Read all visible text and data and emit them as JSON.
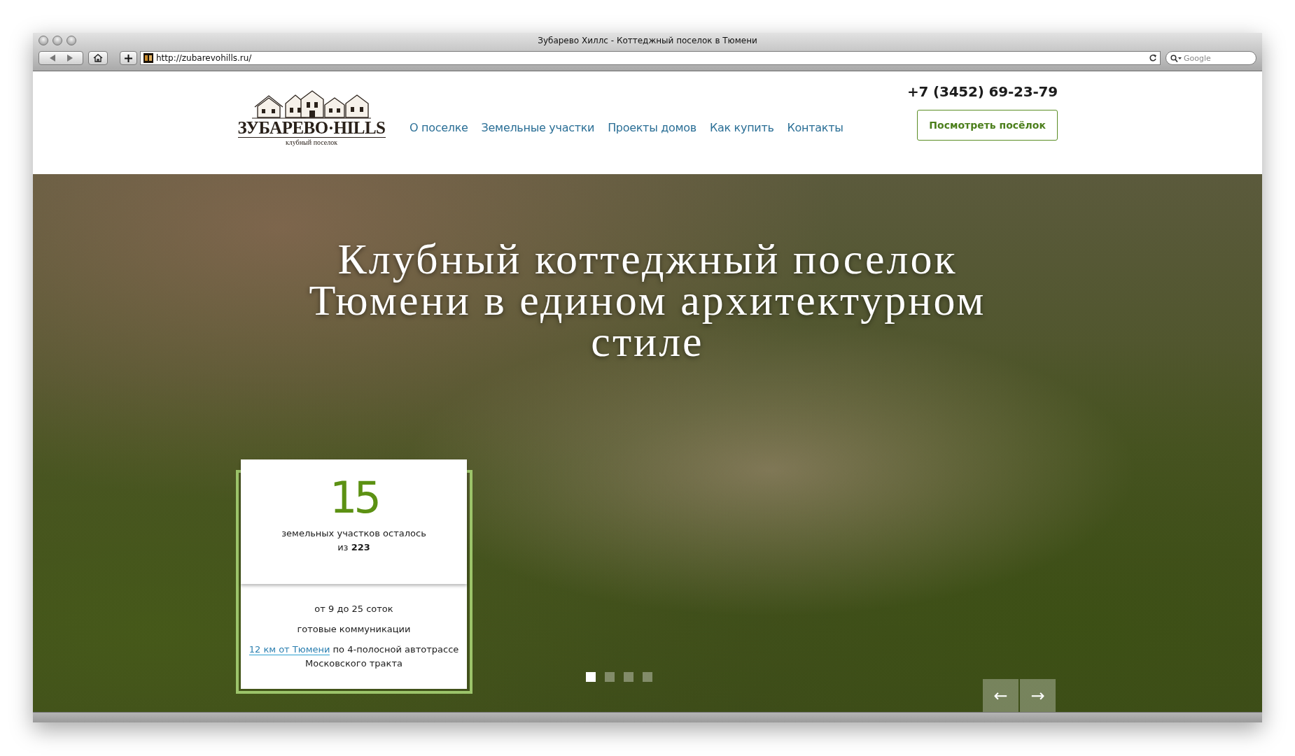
{
  "window": {
    "title": "Зубарево Хиллс - Коттеджный поселок в Тюмени",
    "url": "http://zubarevohills.ru/",
    "search_placeholder": "Google"
  },
  "header": {
    "logo": {
      "name": "ЗУБАРЕВО·HILLS",
      "tagline": "клубный поселок"
    },
    "nav": [
      {
        "label": "О поселке"
      },
      {
        "label": "Земельные участки"
      },
      {
        "label": "Проекты домов"
      },
      {
        "label": "Как купить"
      },
      {
        "label": "Контакты"
      }
    ],
    "phone": "+7 (3452) 69-23-79",
    "cta": "Посмотреть посёлок"
  },
  "hero": {
    "title": "Клубный коттеджный поселок Тюмени в едином архитектурном стиле",
    "stat": {
      "number": "15",
      "caption": "земельных участков осталось",
      "total": "из **223**"
    },
    "features": [
      {
        "text": "от 9 до 25 соток"
      },
      {
        "text": "готовые коммуникации"
      },
      {
        "link": "12 км от Тюмени",
        "text": " по 4-полосной автотрассе Московского тракта"
      }
    ],
    "slides": [
      {
        "selected": true
      },
      {
        "selected": false
      },
      {
        "selected": false
      },
      {
        "selected": false
      }
    ],
    "prev": "←",
    "next": "→"
  }
}
